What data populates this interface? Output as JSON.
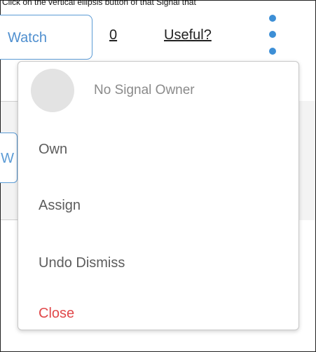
{
  "instruction": "Click on the vertical ellipsis button of that Signal that",
  "signal_bar": {
    "watch_label": "Watch",
    "count": "0",
    "useful_label": "Useful?"
  },
  "background": {
    "partial_button_text": "W"
  },
  "menu": {
    "owner_label": "No Signal Owner",
    "items": [
      {
        "label": "Own"
      },
      {
        "label": "Assign"
      },
      {
        "label": "Undo Dismiss"
      },
      {
        "label": "Close"
      }
    ]
  },
  "colors": {
    "accent": "#3d8fd6",
    "close": "#e0484a"
  },
  "icons": {
    "kebab": "vertical-ellipsis-icon",
    "avatar": "avatar-placeholder"
  }
}
